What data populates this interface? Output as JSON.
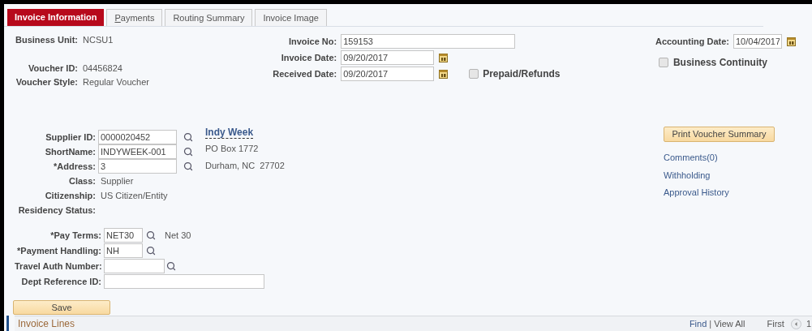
{
  "tabs": [
    {
      "label": "Invoice Information",
      "selected": true,
      "access_key_underlined": false
    },
    {
      "label": "Payments",
      "selected": false,
      "access_key_underlined": true
    },
    {
      "label": "Routing Summary",
      "selected": false,
      "access_key_underlined": false
    },
    {
      "label": "Invoice Image",
      "selected": false,
      "access_key_underlined": false
    }
  ],
  "header": {
    "left": [
      {
        "label": "Business Unit:",
        "value": "NCSU1"
      },
      {
        "label": "Voucher ID:",
        "value": "04456824"
      },
      {
        "label": "Voucher Style:",
        "value": "Regular Voucher"
      }
    ],
    "middle": [
      {
        "label": "Invoice No:",
        "value": "159153",
        "kind": "text"
      },
      {
        "label": "Invoice Date:",
        "value": "09/20/2017",
        "kind": "date"
      },
      {
        "label": "Received Date:",
        "value": "09/20/2017",
        "kind": "date"
      }
    ],
    "prepaid": {
      "label": "Prepaid/Refunds",
      "checked": false
    },
    "accounting_date": {
      "label": "Accounting Date:",
      "value": "10/04/2017"
    },
    "business_continuity": {
      "label": "Business Continuity",
      "checked": false
    }
  },
  "supplier": {
    "fields": [
      {
        "label": "Supplier ID:",
        "value": "0000020452",
        "kind": "lookup"
      },
      {
        "label": "ShortName:",
        "value": "INDYWEEK-001",
        "kind": "lookup"
      },
      {
        "label": "*Address:",
        "value": "3",
        "kind": "lookup"
      },
      {
        "label": "Class:",
        "value": "Supplier",
        "kind": "static"
      },
      {
        "label": "Citizenship:",
        "value": "US Citizen/Entity",
        "kind": "static"
      },
      {
        "label": "Residency Status:",
        "kind": "static"
      }
    ],
    "address": {
      "name": "Indy Week",
      "lines": [
        "PO Box 1772",
        "Durham, NC  27702"
      ]
    },
    "print_button": "Print Voucher Summary",
    "links": [
      "Comments(0)",
      "Withholding",
      "Approval History"
    ]
  },
  "payment": {
    "fields": [
      {
        "label": "*Pay Terms:",
        "value": "NET30",
        "kind": "lookup_short",
        "description": "Net 30"
      },
      {
        "label": "*Payment Handling:",
        "value": "NH",
        "kind": "lookup_short"
      },
      {
        "label": "Travel Auth Number:",
        "kind": "lookup"
      },
      {
        "label": "Dept Reference ID:",
        "kind": "long"
      }
    ]
  },
  "save_button": "Save",
  "invoice_lines": {
    "title": "Invoice Lines",
    "find": "Find",
    "separator": "|",
    "view_all": "View All",
    "first": "First",
    "page": "1"
  }
}
